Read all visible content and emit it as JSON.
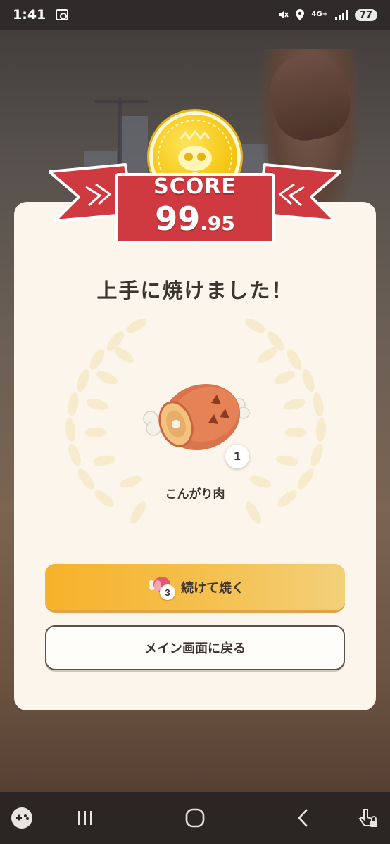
{
  "status_bar": {
    "time": "1:41",
    "network": "4G+",
    "battery": "77"
  },
  "score": {
    "label": "SCORE",
    "integer": "99",
    "decimal": ".95"
  },
  "result": {
    "title": "上手に焼けました！",
    "item_name": "こんがり肉",
    "item_count": "1"
  },
  "buttons": {
    "continue_label": "続けて焼く",
    "continue_count": "3",
    "main_label": "メイン画面に戻る"
  },
  "colors": {
    "ribbon": "#cf3a40",
    "button_primary": "#f6b22a",
    "card": "#fbf5ec",
    "coin": "#f6c919"
  },
  "icons": {
    "nav": [
      "game-controller-icon",
      "recent-apps-icon",
      "home-icon",
      "back-icon",
      "touch-lock-icon"
    ]
  }
}
